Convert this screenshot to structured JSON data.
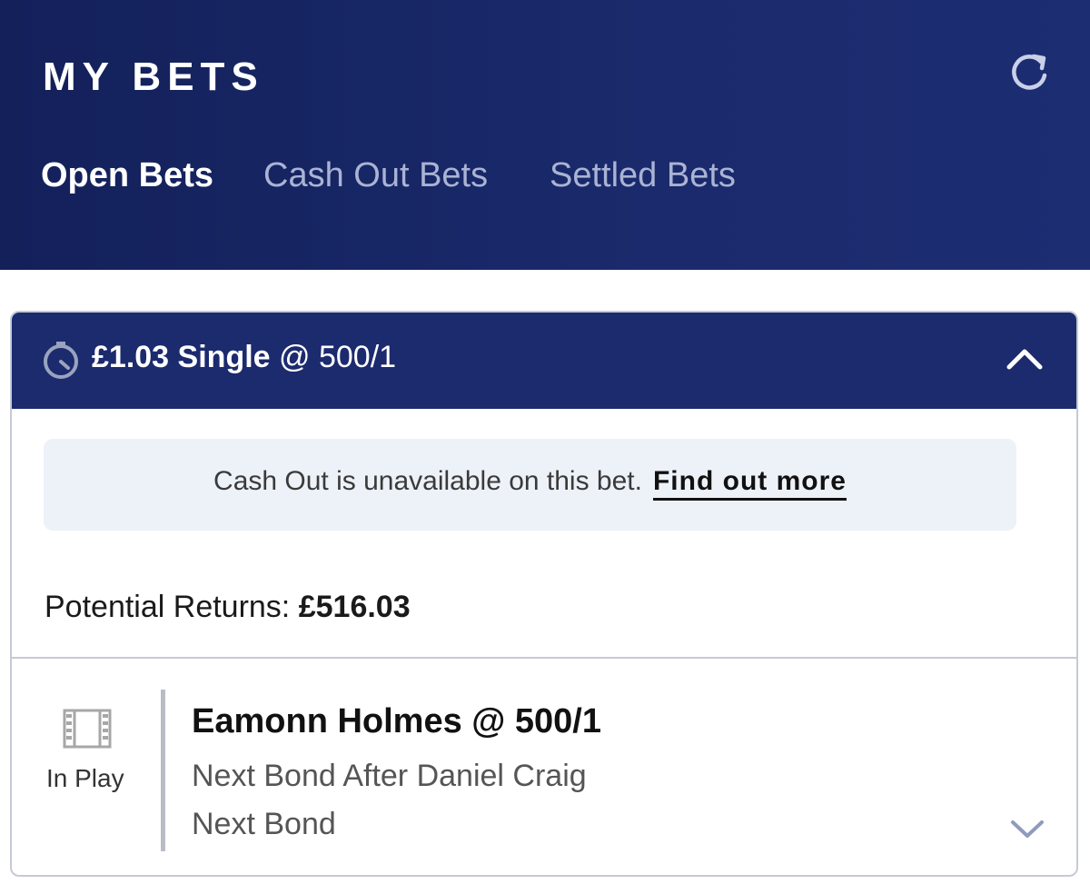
{
  "header": {
    "title": "MY BETS",
    "refresh_icon": "refresh-icon",
    "background_color": "#1a2a6c",
    "tabs": [
      {
        "label": "Open Bets",
        "active": true
      },
      {
        "label": "Cash Out Bets",
        "active": false
      },
      {
        "label": "Settled Bets",
        "active": false
      }
    ]
  },
  "bet": {
    "stake": "£1.03",
    "type": "Single",
    "odds": "@ 500/1",
    "clock_icon": "clock-icon",
    "collapse_icon": "chevron-up-icon",
    "notice": {
      "text": "Cash Out is unavailable on this bet.",
      "link": "Find out more"
    },
    "returns_label": "Potential Returns:",
    "returns_amount": "£516.03",
    "selection": {
      "status_icon": "film-icon",
      "status": "In Play",
      "name": "Eamonn Holmes @ 500/1",
      "market": "Next Bond After Daniel Craig",
      "event": "Next Bond",
      "expand_icon": "chevron-down-icon"
    }
  },
  "colors": {
    "header_bg": "#1a2a6c",
    "card_header_bg": "#1c2a6e",
    "inactive_tab": "#aab3d4",
    "notice_bg": "#edf2f9"
  }
}
